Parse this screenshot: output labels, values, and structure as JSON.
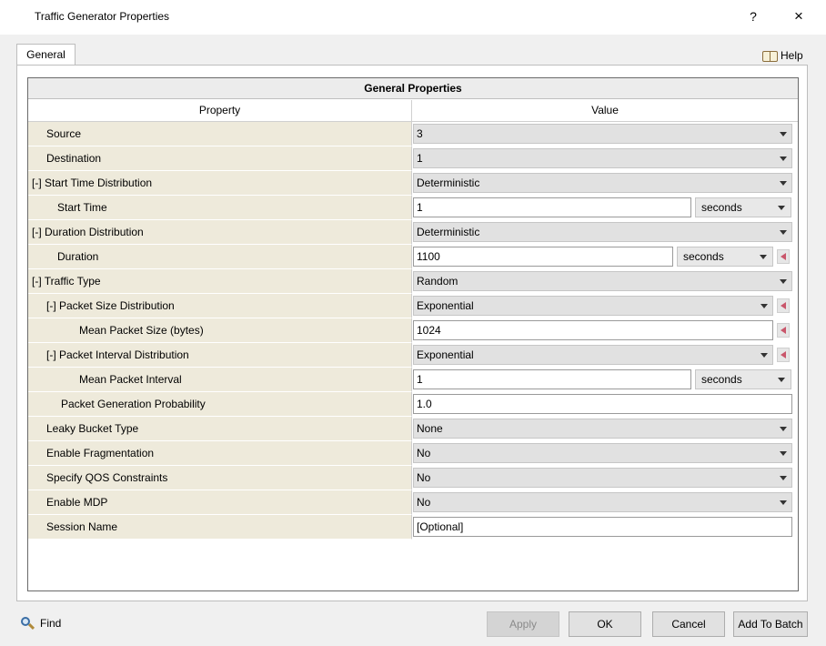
{
  "window": {
    "title": "Traffic Generator Properties",
    "help_char": "?",
    "close_char": "×"
  },
  "tabs": [
    {
      "label": "General"
    }
  ],
  "help_link": {
    "label": "Help"
  },
  "grid": {
    "title": "General Properties",
    "col_property": "Property",
    "col_value": "Value",
    "rows": [
      {
        "label": "Source",
        "value": "3"
      },
      {
        "label": "Destination",
        "value": "1"
      },
      {
        "label": "[-] Start Time Distribution",
        "value": "Deterministic"
      },
      {
        "label": "Start Time",
        "value": "1",
        "unit": "seconds"
      },
      {
        "label": "[-] Duration Distribution",
        "value": "Deterministic"
      },
      {
        "label": "Duration",
        "value": "1100",
        "unit": "seconds"
      },
      {
        "label": "[-] Traffic Type",
        "value": "Random"
      },
      {
        "label": "[-] Packet Size Distribution",
        "value": "Exponential"
      },
      {
        "label": "Mean Packet Size (bytes)",
        "value": "1024"
      },
      {
        "label": "[-] Packet Interval Distribution",
        "value": "Exponential"
      },
      {
        "label": "Mean Packet Interval",
        "value": "1",
        "unit": "seconds"
      },
      {
        "label": "Packet Generation Probability",
        "value": "1.0"
      },
      {
        "label": "Leaky Bucket Type",
        "value": "None"
      },
      {
        "label": "Enable Fragmentation",
        "value": "No"
      },
      {
        "label": "Specify QOS Constraints",
        "value": "No"
      },
      {
        "label": "Enable MDP",
        "value": "No"
      },
      {
        "label": "Session Name",
        "value": "[Optional]"
      }
    ]
  },
  "footer": {
    "find_label": "Find",
    "apply_label": "Apply",
    "ok_label": "OK",
    "cancel_label": "Cancel",
    "batch_label": "Add To Batch"
  }
}
